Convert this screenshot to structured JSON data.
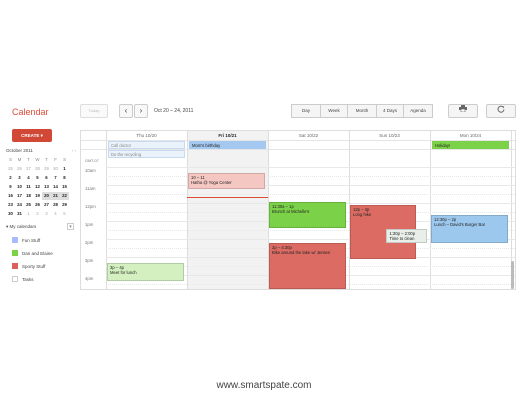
{
  "app": {
    "title": "Calendar"
  },
  "toolbar": {
    "today_label": "Today",
    "prev_glyph": "‹",
    "next_glyph": "›",
    "date_range": "Oct 20 – 24, 2011",
    "views": [
      "Day",
      "Week",
      "Month",
      "4 Days",
      "Agenda"
    ],
    "print_icon": "print-icon",
    "refresh_icon": "refresh-icon"
  },
  "sidebar": {
    "create_label": "CREATE",
    "mini_cal": {
      "month": "October 2011",
      "days": [
        "S",
        "M",
        "T",
        "W",
        "T",
        "F",
        "S"
      ],
      "weeks": [
        [
          "25",
          "26",
          "27",
          "28",
          "29",
          "30",
          "1"
        ],
        [
          "2",
          "3",
          "4",
          "5",
          "6",
          "7",
          "8"
        ],
        [
          "9",
          "10",
          "11",
          "12",
          "13",
          "14",
          "15"
        ],
        [
          "16",
          "17",
          "18",
          "19",
          "20",
          "21",
          "22"
        ],
        [
          "23",
          "24",
          "25",
          "26",
          "27",
          "28",
          "29"
        ],
        [
          "30",
          "31",
          "1",
          "2",
          "3",
          "4",
          "5"
        ]
      ]
    },
    "my_calendars_label": "My calendars",
    "calendars": [
      {
        "name": "Fun Stuff",
        "color": "#a4bdfc"
      },
      {
        "name": "Dan and Elaine",
        "color": "#7bd148"
      },
      {
        "name": "Sporty Stuff",
        "color": "#dc5f5a"
      },
      {
        "name": "Tasks",
        "color": "#ffffff"
      }
    ]
  },
  "grid": {
    "timezone": "GMT-07",
    "days": [
      "Thu 10/20",
      "Fri 10/21",
      "Sat 10/22",
      "Sun 10/23",
      "Mon 10/24"
    ],
    "hours": [
      "10am",
      "11am",
      "12pm",
      "1pm",
      "2pm",
      "3pm",
      "4pm"
    ],
    "allday": [
      {
        "day": 0,
        "row": 0,
        "text": "Call doctor",
        "color": "#eaf2fb"
      },
      {
        "day": 1,
        "row": 0,
        "text": "Mom's birthday",
        "color": "#a4c8f0"
      },
      {
        "day": 4,
        "row": 0,
        "text": "Holiday!",
        "color": "#7bd148"
      },
      {
        "day": 0,
        "row": 1,
        "text": "Do the recycling",
        "color": "#eaf2fb"
      }
    ],
    "events": [
      {
        "day": 1,
        "time": "10 – 11",
        "title": "Hatha @ Yoga Center",
        "color": "#f5c7c3"
      },
      {
        "day": 2,
        "time": "11:30a – 1p",
        "title": "Brunch at Michelle's",
        "color": "#7bd148"
      },
      {
        "day": 3,
        "time": "12p – 3p",
        "title": "Long hike",
        "color": "#dc6b63"
      },
      {
        "day": 3,
        "time": "1:30p – 2:00p",
        "title": "Time to clean",
        "color": "#e8eee8"
      },
      {
        "day": 4,
        "time": "12:30p – 2p",
        "title": "Lunch – David's Burger Bar",
        "color": "#9dc8ed"
      },
      {
        "day": 2,
        "time": "2p – 4:30p",
        "title": "Bike around the lake w/ Jensen",
        "color": "#dc6b63"
      },
      {
        "day": 0,
        "time": "3p – 4p",
        "title": "Meet for lunch",
        "color": "#d4f0c0"
      }
    ]
  },
  "footer": {
    "text": "www.smartspate.com"
  }
}
